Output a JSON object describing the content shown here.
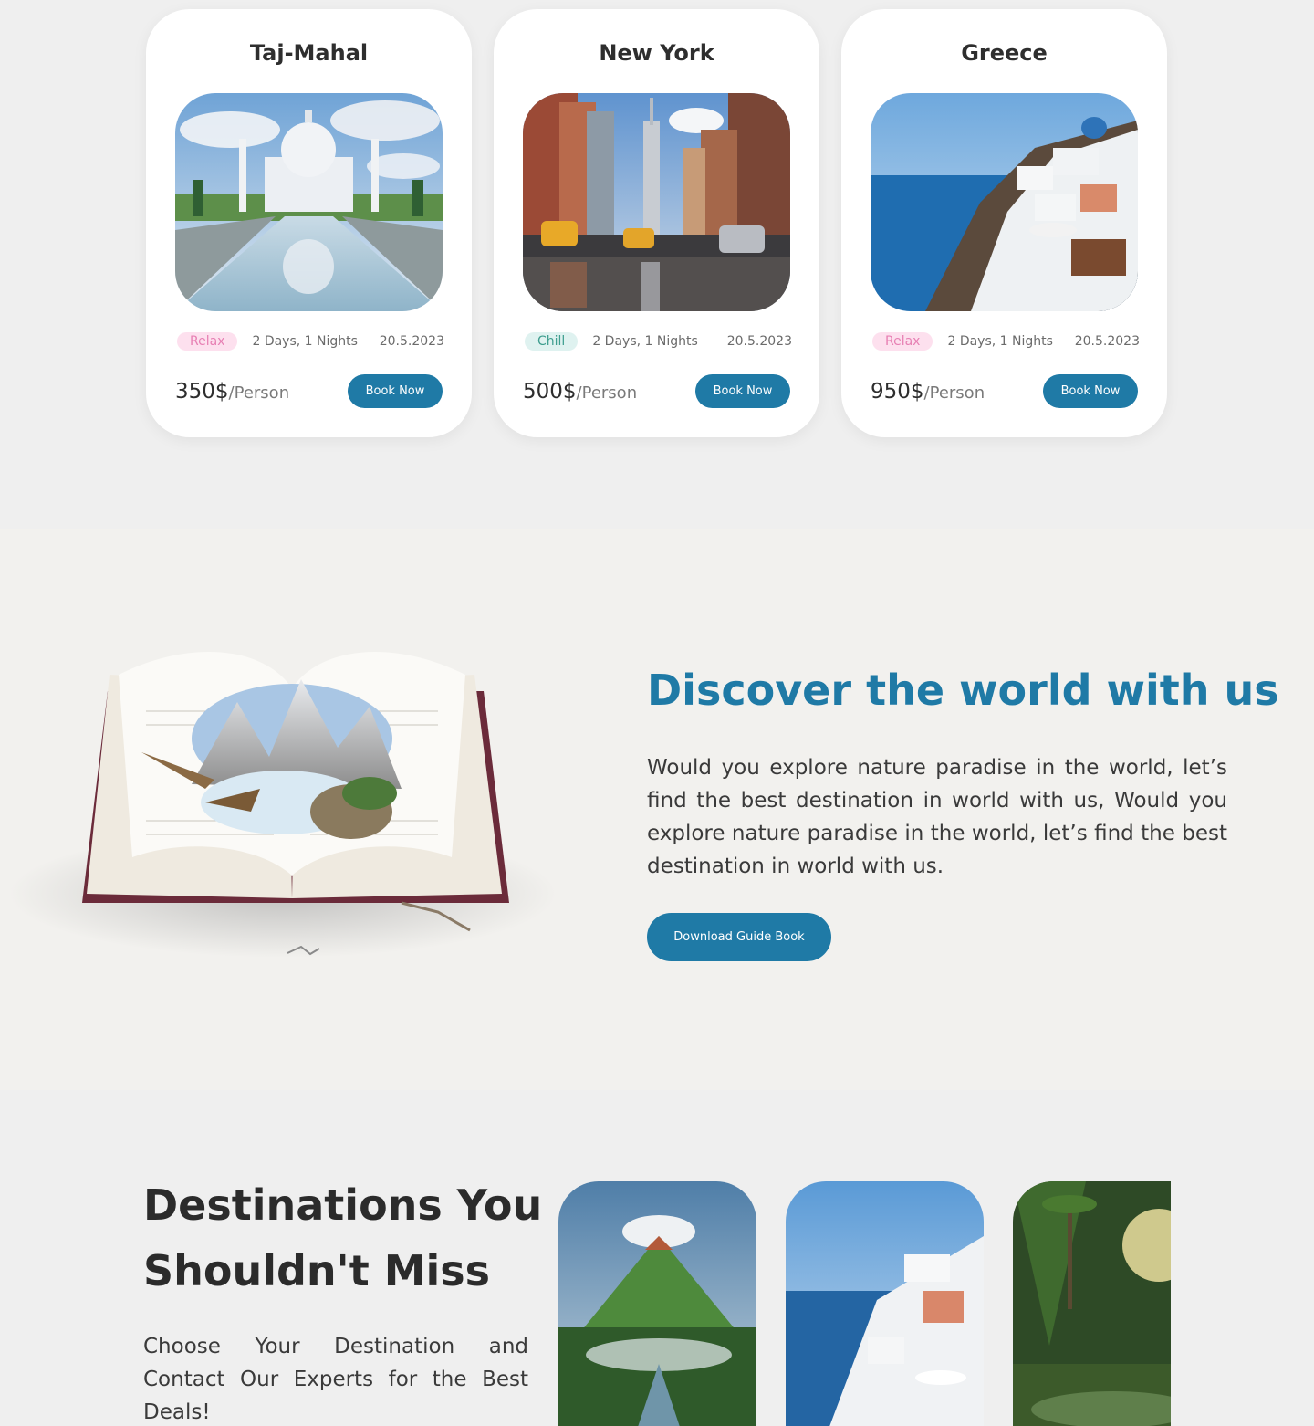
{
  "tours": [
    {
      "title": "Taj-Mahal",
      "tag": "Relax",
      "duration": "2 Days, 1 Nights",
      "date": "20.5.2023",
      "price": "350$",
      "per": "/Person",
      "button": "Book Now"
    },
    {
      "title": "New York",
      "tag": "Chill",
      "duration": "2 Days, 1 Nights",
      "date": "20.5.2023",
      "price": "500$",
      "per": "/Person",
      "button": "Book Now"
    },
    {
      "title": "Greece",
      "tag": "Relax",
      "duration": "2 Days, 1 Nights",
      "date": "20.5.2023",
      "price": "950$",
      "per": "/Person",
      "button": "Book Now"
    }
  ],
  "discover": {
    "title": "Discover the world with us",
    "text": "Would you explore nature paradise in the world, let’s find the best destination in world with us, Would you explore nature paradise in the world, let’s find the best destination in world with us.",
    "button": "Download Guide Book"
  },
  "destinations": {
    "title": "Destinations You Shouldn't Miss",
    "text": "Choose Your Destination and Contact Our Experts for the Best Deals!"
  },
  "colors": {
    "accent": "#1f7aa6",
    "relax_tag_bg": "#fde0ee",
    "relax_tag_text": "#e77fb3",
    "chill_tag_bg": "#dff2f0",
    "chill_tag_text": "#3f9e8f"
  }
}
